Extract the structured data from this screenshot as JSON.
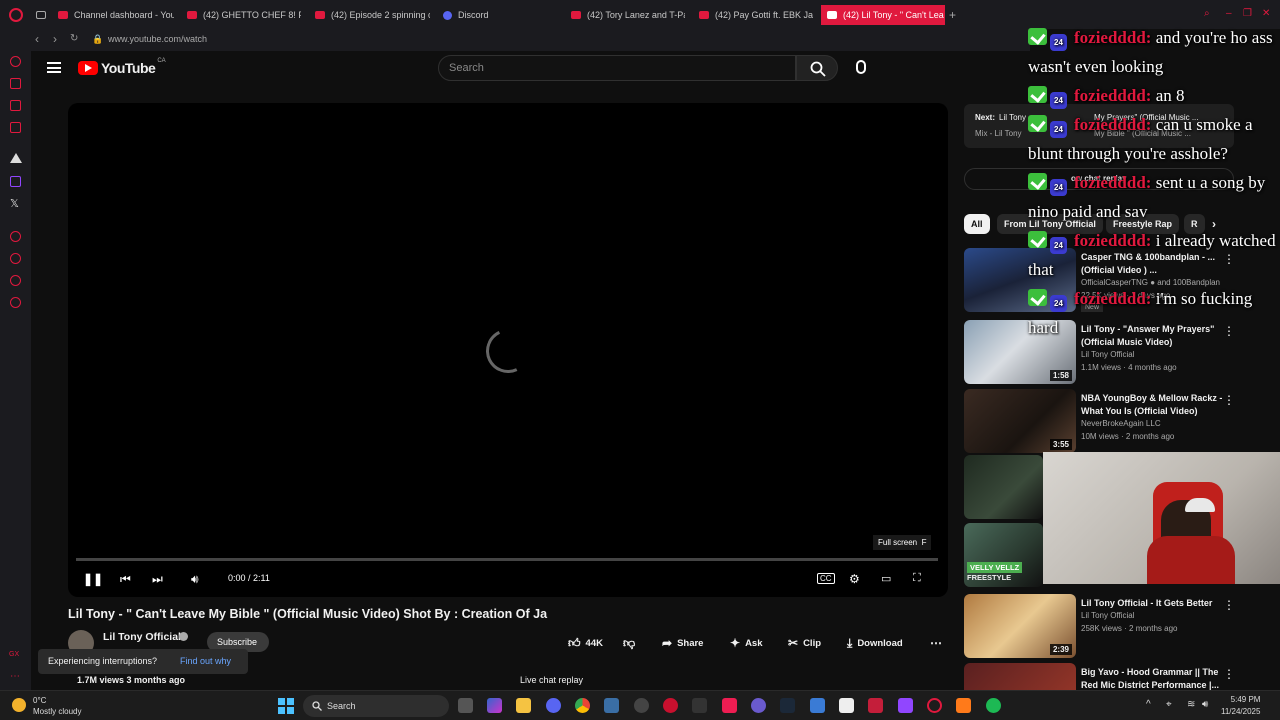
{
  "browser": {
    "tabs": [
      {
        "label": "Channel dashboard - You",
        "icon": "youtube-icon"
      },
      {
        "label": "(42) GHETTO CHEF 8! FE",
        "icon": "youtube-icon"
      },
      {
        "label": "(42) Episode 2 spinning c",
        "icon": "youtube-icon"
      },
      {
        "label": "Discord",
        "icon": "discord-icon"
      },
      {
        "label": "(42) Tory Lanez and T-Pa",
        "icon": "youtube-icon"
      },
      {
        "label": "(42) Pay Gotti ft. EBK Jaa",
        "icon": "youtube-icon"
      },
      {
        "label": "(42) Lil Tony - \" Can't Lea",
        "icon": "youtube-icon"
      }
    ],
    "new_tab": "+",
    "url": "www.youtube.com/watch"
  },
  "youtube": {
    "logo_text": "YouTube",
    "region": "CA",
    "search_placeholder": "Search"
  },
  "player": {
    "time": "0:00 / 2:11",
    "fullscreen_tip": "Full screen",
    "fullscreen_key": "F",
    "progress": 0
  },
  "video": {
    "title": "Lil Tony - \" Can't Leave My Bible \" (Official Music Video) Shot By : Creation Of Ja",
    "channel": "Lil Tony Official",
    "subscribe": "Subscribe",
    "views": "1.7M views  3 months ago",
    "likes": "44K",
    "share": "Share",
    "ask": "Ask",
    "clip": "Clip",
    "download": "Download",
    "live_chat_replay": "Live chat replay"
  },
  "interruption": {
    "text": "Experiencing interruptions?",
    "link": "Find out why"
  },
  "next_card": {
    "label": "Next:",
    "title": "Lil Tony",
    "title_tail": "My Prayers\" (Official Music ...",
    "sub": "Mix - Lil Tony",
    "sub_tail": "My Bible \" (Official Music ..."
  },
  "show_chat_replay": "ow chat replay",
  "chips": [
    "All",
    "From Lil Tony Official",
    "Freestyle Rap",
    "R"
  ],
  "recommendations": [
    {
      "title": "Casper TNG & 100bandplan - ...(Official Video ) ...",
      "channel": "OfficialCasperTNG",
      "channel_extra": "and 100Bandplan",
      "meta": "22.5K views · 1 days ago",
      "badge": "New",
      "duration": ""
    },
    {
      "title": "Lil Tony - \"Answer My Prayers\" (Official Music Video)",
      "channel": "Lil Tony Official",
      "meta": "1.1M views · 4 months ago",
      "duration": "1:58"
    },
    {
      "title": "NBA YoungBoy & Mellow Rackz - What You Is (Official Video)",
      "channel": "NeverBrokeAgain LLC",
      "meta": "10M views · 2 months ago",
      "duration": "3:55"
    },
    {
      "title": "Lil Tony Official - It Gets Better",
      "channel": "Lil Tony Official",
      "meta": "258K views · 2 months ago",
      "duration": "2:39"
    },
    {
      "title": "Big Yavo - Hood Grammar || The Red Mic District Performance |...",
      "channel": "",
      "meta": "",
      "duration": ""
    }
  ],
  "velly_overlay": {
    "line1": "VELLY VELLZ",
    "line2": "FREESTYLE"
  },
  "chat_overlay": [
    {
      "name": "foziedddd:",
      "text": " and you're ho ass wasn't even looking"
    },
    {
      "name": "foziedddd:",
      "text": " an 8"
    },
    {
      "name": "foziedddd:",
      "text": " can u smoke a blunt through you're asshole?"
    },
    {
      "name": "foziedddd:",
      "text": " sent u a song by nino paid and sav"
    },
    {
      "name": "foziedddd:",
      "text": " i already watched that"
    },
    {
      "name": "foziedddd:",
      "text": " i'm so fucking hard"
    }
  ],
  "chat_badge_text": "24",
  "taskbar": {
    "temp": "0°C",
    "weather": "Mostly cloudy",
    "search": "Search",
    "time": "5:49 PM",
    "date": "11/24/2025"
  },
  "colors": {
    "opera_red": "#e0193e",
    "youtube_red": "#ff0000",
    "background": "#0f0f0f",
    "chat_name": "#e0193e",
    "badge_green": "#3cbf3c"
  }
}
